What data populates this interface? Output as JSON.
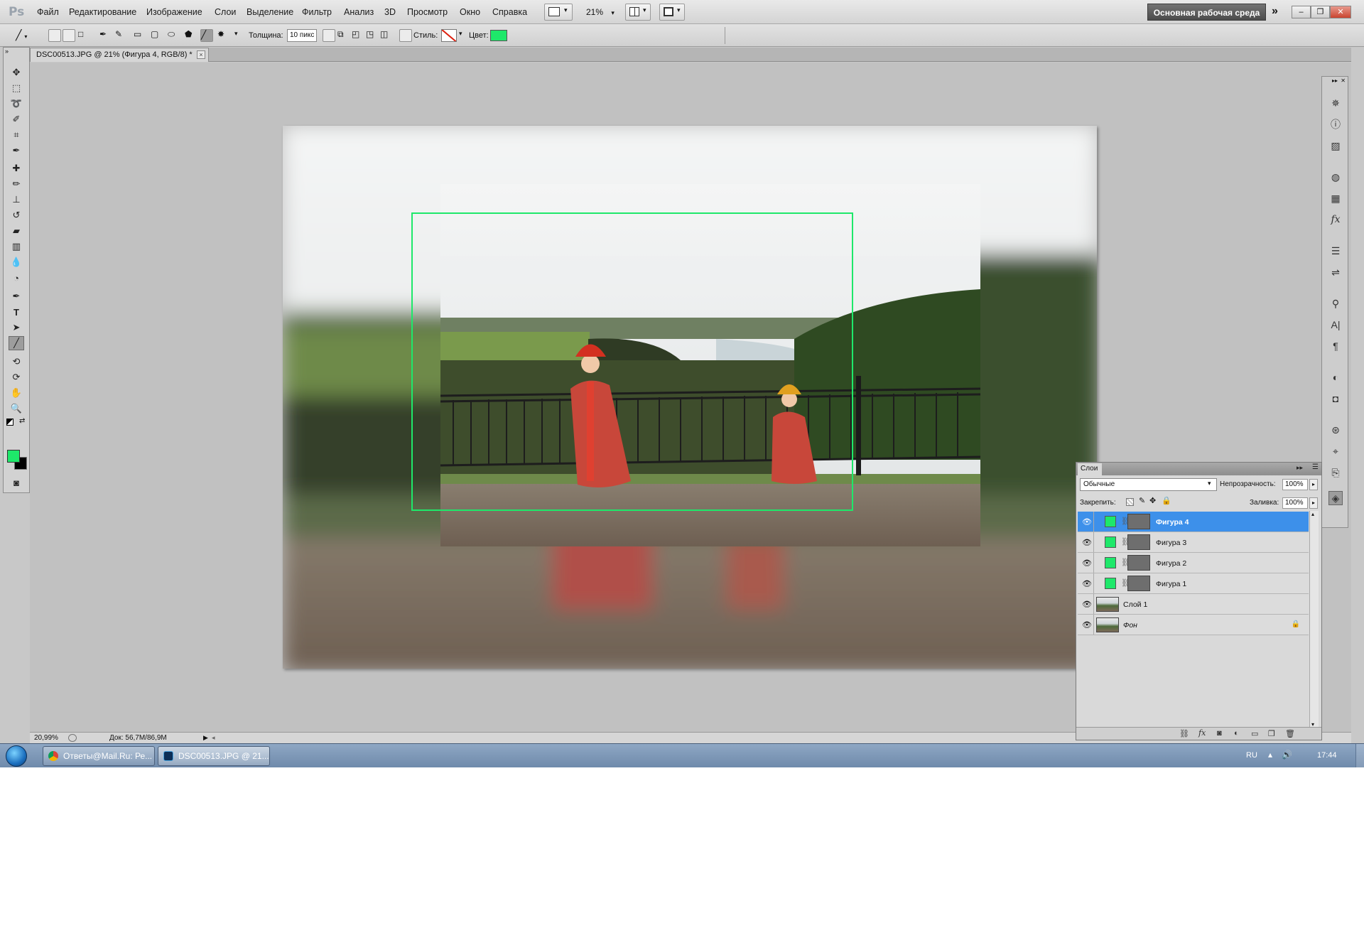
{
  "app": {
    "logo": "Ps"
  },
  "menubar": {
    "items": [
      "Файл",
      "Редактирование",
      "Изображение",
      "Слои",
      "Выделение",
      "Фильтр",
      "Анализ",
      "3D",
      "Просмотр",
      "Окно",
      "Справка"
    ],
    "zoom": "21%",
    "workspace": "Основная рабочая среда"
  },
  "options": {
    "thickness_label": "Толщина:",
    "thickness_value": "10 пикс",
    "style_label": "Стиль:",
    "color_label": "Цвет:",
    "color_value": "#1ee86a"
  },
  "document": {
    "tab_title": "DSC00513.JPG @ 21% (Фигура 4, RGB/8) *",
    "tab_close": "×",
    "frame_color": "#1ee86a"
  },
  "status": {
    "zoom": "20,99%",
    "doc_size": "Док: 56,7M/86,9M"
  },
  "toolbox": {
    "foreground": "#1ee86a",
    "background": "#000000",
    "tools": [
      "move-icon",
      "marquee-icon",
      "lasso-icon",
      "quick-select-icon",
      "crop-icon",
      "eyedropper-icon",
      "healing-icon",
      "brush-icon",
      "clone-stamp-icon",
      "history-brush-icon",
      "eraser-icon",
      "gradient-icon",
      "blur-icon",
      "dodge-icon",
      "pen-icon",
      "type-icon",
      "path-select-icon",
      "line-shape-icon",
      "3d-rotate-icon",
      "3d-orbit-icon",
      "hand-icon",
      "zoom-icon"
    ]
  },
  "dock": {
    "icons": [
      "navigator-icon",
      "info-icon",
      "histogram-icon",
      "color-icon",
      "swatches-icon",
      "styles-icon",
      "adjustments-icon",
      "masks-icon",
      "brushes-icon",
      "character-icon",
      "paragraph-icon",
      "3d-icon",
      "channels-icon",
      "clone-source-icon",
      "paths-icon",
      "layers-icon"
    ]
  },
  "layers_panel": {
    "tab": "Слои",
    "blend_mode": "Обычные",
    "opacity_label": "Непрозрачность:",
    "opacity": "100%",
    "lock_label": "Закрепить:",
    "fill_label": "Заливка:",
    "fill": "100%",
    "layers": [
      {
        "name": "Фигура 4",
        "selected": true,
        "kind": "shape"
      },
      {
        "name": "Фигура 3",
        "selected": false,
        "kind": "shape"
      },
      {
        "name": "Фигура 2",
        "selected": false,
        "kind": "shape"
      },
      {
        "name": "Фигура 1",
        "selected": false,
        "kind": "shape"
      },
      {
        "name": "Слой 1",
        "selected": false,
        "kind": "image"
      },
      {
        "name": "Фон",
        "selected": false,
        "kind": "image",
        "locked": true
      }
    ]
  },
  "taskbar": {
    "tasks": [
      "Ответы@Mail.Ru: Ре...",
      "DSC00513.JPG @ 21..."
    ],
    "lang": "RU",
    "time": "17:44"
  }
}
